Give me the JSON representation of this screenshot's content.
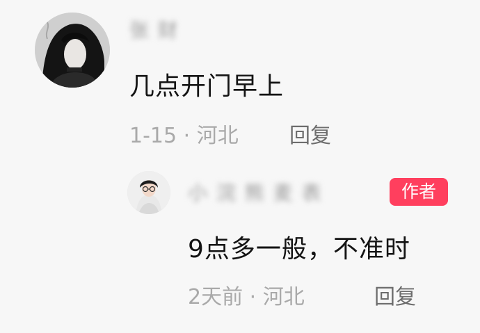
{
  "comments": [
    {
      "avatar_icon": "avatar-woman-dark-hair-icon",
      "username": "张 财",
      "text": "几点开门早上",
      "meta": "1-15 · 河北",
      "reply_label": "回复"
    },
    {
      "avatar_icon": "avatar-woman-glasses-icon",
      "username": "小 浣 熊 麦 表",
      "badge": "作者",
      "text": "9点多一般，不准时",
      "meta": "2天前 · 河北",
      "reply_label": "回复"
    }
  ],
  "colors": {
    "badge": "#ff3f5e",
    "meta": "#a9a9a9",
    "reply": "#6d6d6d",
    "background": "#f7f7f7"
  }
}
